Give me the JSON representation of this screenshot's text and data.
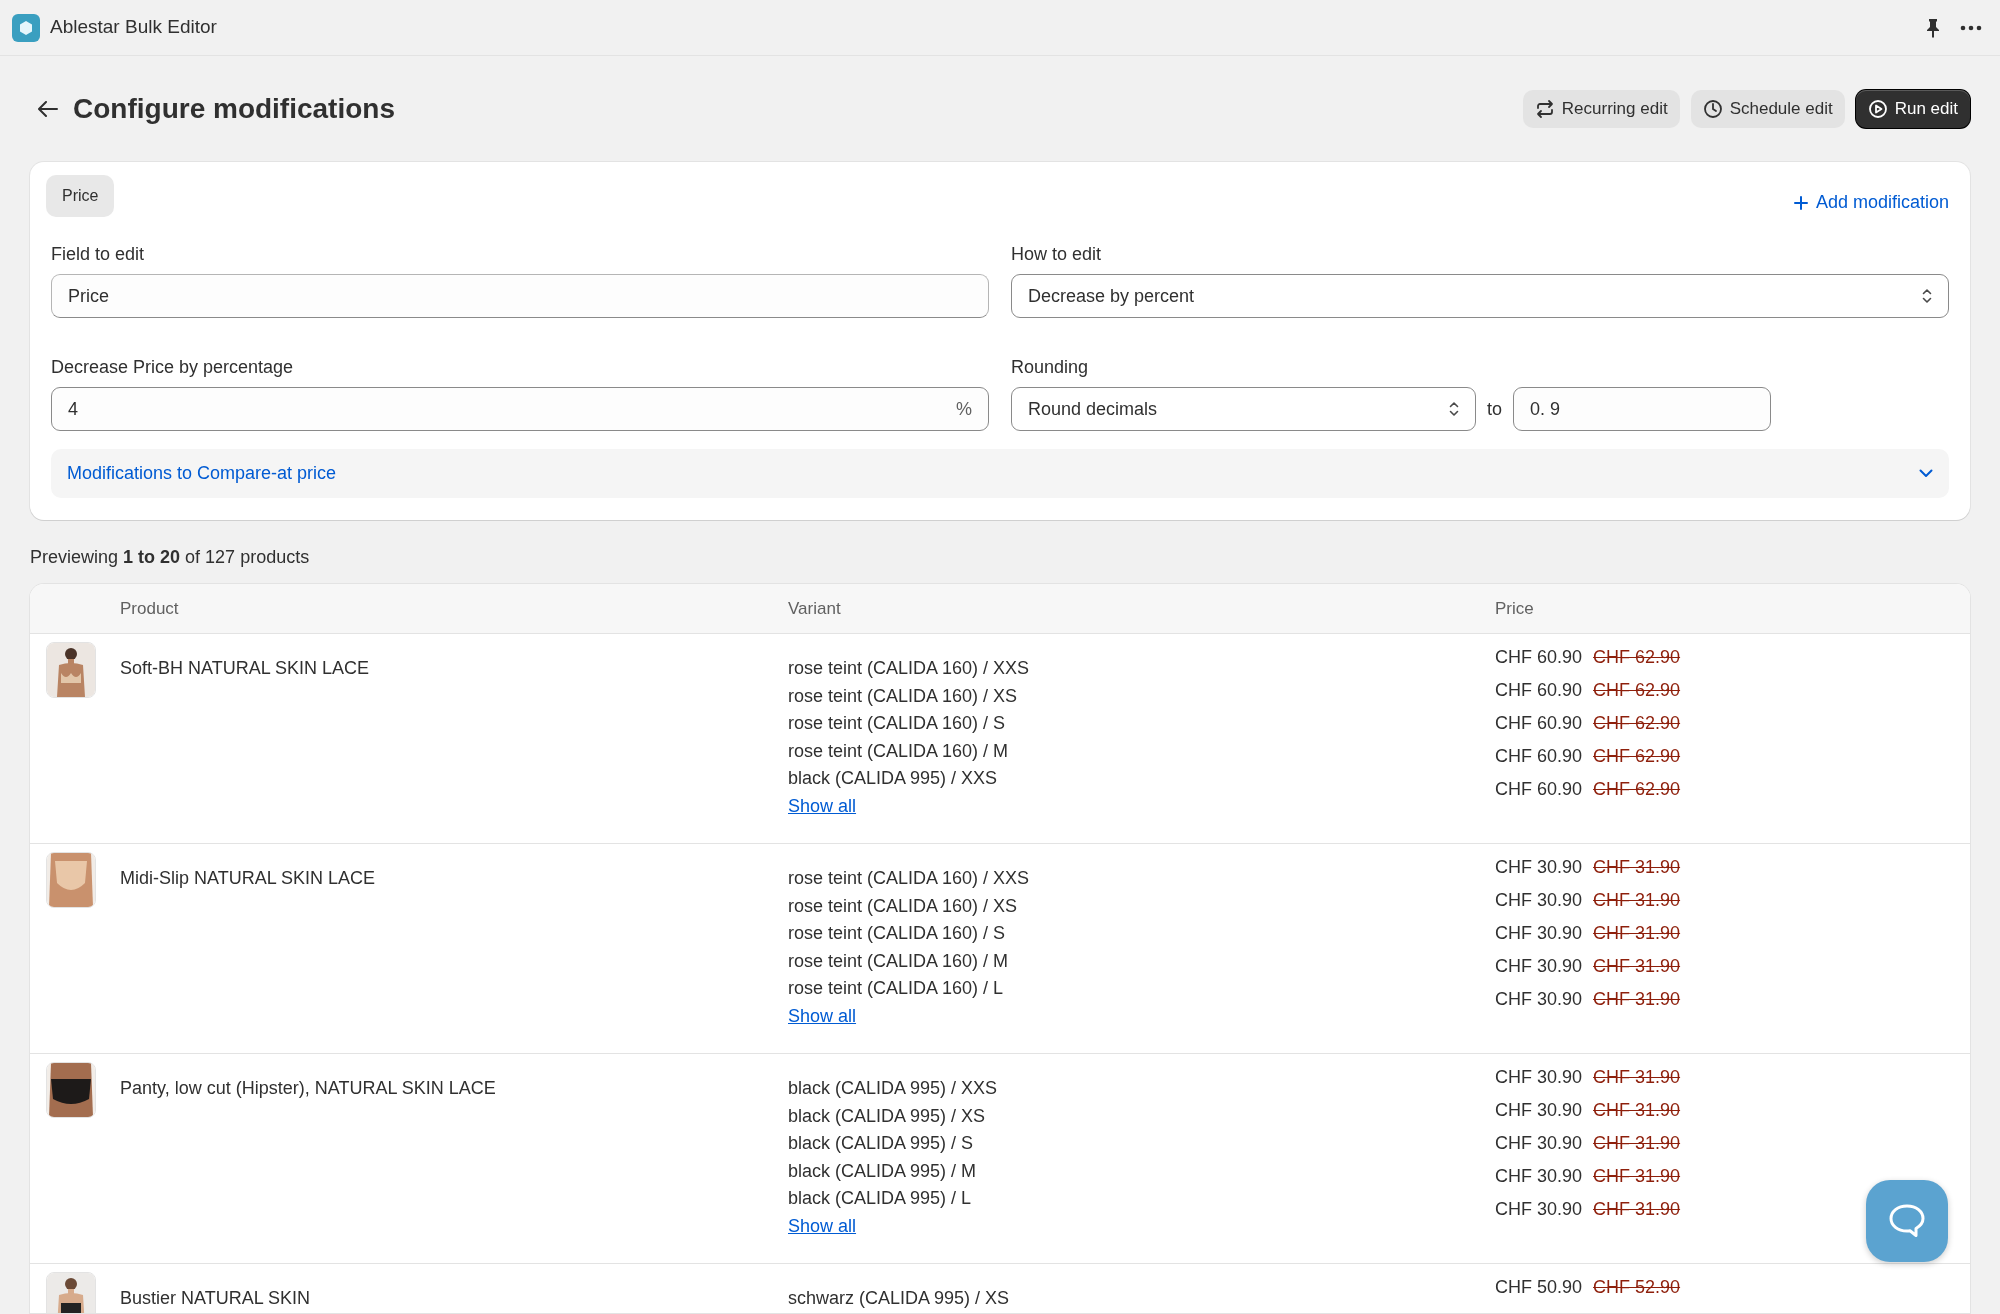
{
  "app_bar": {
    "title": "Ablestar Bulk Editor"
  },
  "header": {
    "title": "Configure modifications",
    "buttons": [
      {
        "label": "Recurring edit",
        "kind": "recurring"
      },
      {
        "label": "Schedule edit",
        "kind": "schedule"
      },
      {
        "label": "Run edit",
        "kind": "run"
      }
    ]
  },
  "modification": {
    "tag": "Price",
    "add_link": "Add modification",
    "field_to_edit": {
      "label": "Field to edit",
      "value": "Price"
    },
    "how_to_edit": {
      "label": "How to edit",
      "value": "Decrease by percent"
    },
    "percentage": {
      "label": "Decrease Price by percentage",
      "value": "4",
      "suffix": "%"
    },
    "rounding": {
      "label": "Rounding",
      "value": "Round decimals",
      "to_label": "to",
      "to_value": "0. 9"
    },
    "compare_at": {
      "label": "Modifications to Compare-at price",
      "expanded": false
    }
  },
  "preview": {
    "summary": "Previewing **1 to 20** of 127 products"
  },
  "table": {
    "columns": [
      "Product",
      "Variant",
      "Price"
    ],
    "rows": [
      {
        "product": "Soft-BH NATURAL SKIN LACE",
        "variants": [
          "rose teint (CALIDA 160) / XXS",
          "rose teint (CALIDA 160) / XS",
          "rose teint (CALIDA 160) / S",
          "rose teint (CALIDA 160) / M",
          "black (CALIDA 995) / XXS"
        ],
        "show_all": "Show all",
        "prices": [
          {
            "price": "CHF 60.90",
            "compare": "CHF 62.90"
          },
          {
            "price": "CHF 60.90",
            "compare": "CHF 62.90"
          },
          {
            "price": "CHF 60.90",
            "compare": "CHF 62.90"
          },
          {
            "price": "CHF 60.90",
            "compare": "CHF 62.90"
          },
          {
            "price": "CHF 60.90",
            "compare": "CHF 62.90"
          }
        ]
      },
      {
        "product": "Midi-Slip NATURAL SKIN LACE",
        "variants": [
          "rose teint (CALIDA 160) / XXS",
          "rose teint (CALIDA 160) / XS",
          "rose teint (CALIDA 160) / S",
          "rose teint (CALIDA 160) / M",
          "rose teint (CALIDA 160) / L"
        ],
        "show_all": "Show all",
        "prices": [
          {
            "price": "CHF 30.90",
            "compare": "CHF 31.90"
          },
          {
            "price": "CHF 30.90",
            "compare": "CHF 31.90"
          },
          {
            "price": "CHF 30.90",
            "compare": "CHF 31.90"
          },
          {
            "price": "CHF 30.90",
            "compare": "CHF 31.90"
          },
          {
            "price": "CHF 30.90",
            "compare": "CHF 31.90"
          }
        ]
      },
      {
        "product": "Panty, low cut (Hipster), NATURAL SKIN LACE",
        "variants": [
          "black (CALIDA 995) / XXS",
          "black (CALIDA 995) / XS",
          "black (CALIDA 995) / S",
          "black (CALIDA 995) / M",
          "black (CALIDA 995) / L"
        ],
        "show_all": "Show all",
        "prices": [
          {
            "price": "CHF 30.90",
            "compare": "CHF 31.90"
          },
          {
            "price": "CHF 30.90",
            "compare": "CHF 31.90"
          },
          {
            "price": "CHF 30.90",
            "compare": "CHF 31.90"
          },
          {
            "price": "CHF 30.90",
            "compare": "CHF 31.90"
          },
          {
            "price": "CHF 30.90",
            "compare": "CHF 31.90"
          }
        ]
      },
      {
        "product": "Bustier NATURAL SKIN",
        "variants": [
          "schwarz (CALIDA 995) / XS"
        ],
        "prices": [
          {
            "price": "CHF 50.90",
            "compare": "CHF 52.90"
          }
        ]
      }
    ]
  }
}
